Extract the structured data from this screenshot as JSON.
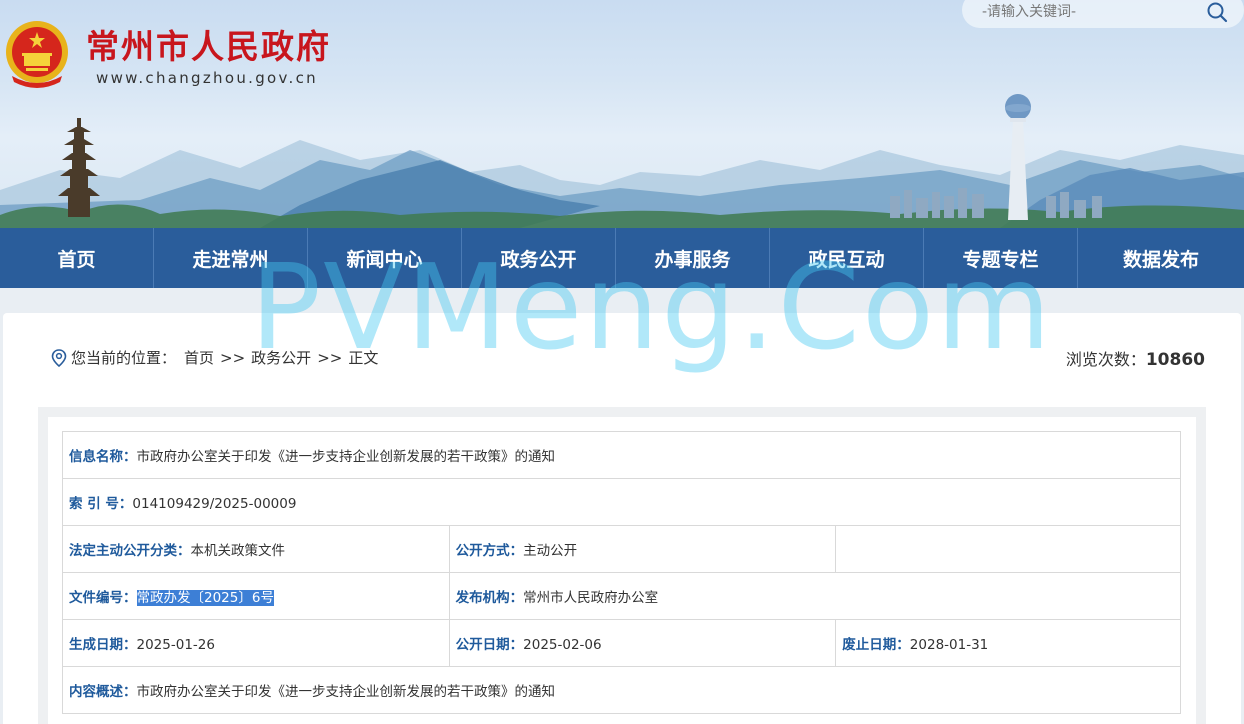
{
  "header": {
    "site_title": "常州市人民政府",
    "site_url": "www.changzhou.gov.cn",
    "search_placeholder": "-请输入关键词-"
  },
  "nav": {
    "items": [
      "首页",
      "走进常州",
      "新闻中心",
      "政务公开",
      "办事服务",
      "政民互动",
      "专题专栏",
      "数据发布"
    ]
  },
  "breadcrumb": {
    "prefix": "您当前的位置：",
    "items": [
      "首页",
      "政务公开",
      "正文"
    ],
    "separator": ">>"
  },
  "views": {
    "label": "浏览次数：",
    "count": "10860"
  },
  "info": {
    "name_label": "信息名称：",
    "name_value": "市政府办公室关于印发《进一步支持企业创新发展的若干政策》的通知",
    "index_label": "索 引 号：",
    "index_value": "014109429/2025-00009",
    "category_label": "法定主动公开分类：",
    "category_value": "本机关政策文件",
    "mode_label": "公开方式：",
    "mode_value": "主动公开",
    "docno_label": "文件编号：",
    "docno_value": "常政办发〔2025〕6号",
    "publisher_label": "发布机构：",
    "publisher_value": "常州市人民政府办公室",
    "created_label": "生成日期：",
    "created_value": "2025-01-26",
    "published_label": "公开日期：",
    "published_value": "2025-02-06",
    "expire_label": "废止日期：",
    "expire_value": "2028-01-31",
    "summary_label": "内容概述：",
    "summary_value": "市政府办公室关于印发《进一步支持企业创新发展的若干政策》的通知"
  },
  "watermark": "PVMeng.Com",
  "colors": {
    "nav_bg": "#2a5d9b",
    "title_red": "#c8161d",
    "label_blue": "#1f5a9c"
  }
}
